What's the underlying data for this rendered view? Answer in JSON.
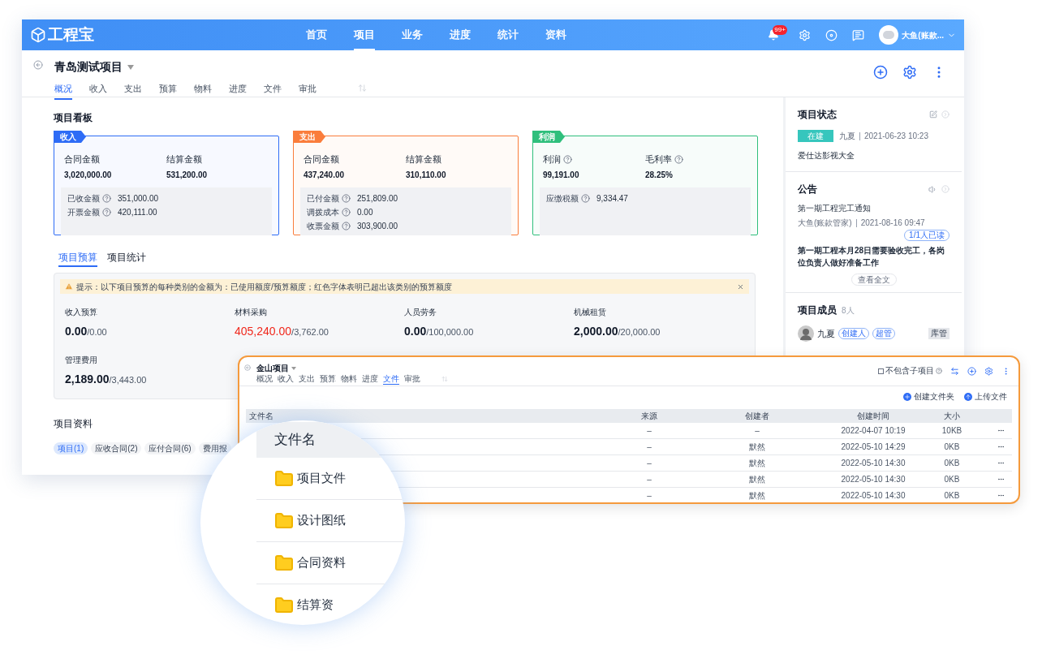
{
  "app": {
    "logo": "工程宝",
    "nav": [
      {
        "label": "首页",
        "selected": false
      },
      {
        "label": "项目",
        "selected": true
      },
      {
        "label": "业务",
        "selected": false
      },
      {
        "label": "进度",
        "selected": false
      },
      {
        "label": "统计",
        "selected": false
      },
      {
        "label": "资料",
        "selected": false
      }
    ],
    "notification_badge": "99+",
    "user_name": "大鱼(账款..."
  },
  "project": {
    "title": "青岛测试项目",
    "tabs": [
      {
        "label": "概况",
        "selected": true
      },
      {
        "label": "收入",
        "selected": false
      },
      {
        "label": "支出",
        "selected": false
      },
      {
        "label": "预算",
        "selected": false
      },
      {
        "label": "物料",
        "selected": false
      },
      {
        "label": "进度",
        "selected": false
      },
      {
        "label": "文件",
        "selected": false
      },
      {
        "label": "审批",
        "selected": false
      }
    ]
  },
  "board": {
    "title": "项目看板",
    "cards": [
      {
        "tag": "收入",
        "color": "#2e6cf6",
        "main": [
          {
            "label": "合同金额",
            "value": "3,020,000.00",
            "help": false
          },
          {
            "label": "结算金额",
            "value": "531,200.00",
            "help": false
          }
        ],
        "details": [
          {
            "label": "已收金额",
            "value": "351,000.00"
          },
          {
            "label": "开票金额",
            "value": "420,111.00"
          }
        ]
      },
      {
        "tag": "支出",
        "color": "#fa7d3c",
        "main": [
          {
            "label": "合同金额",
            "value": "437,240.00",
            "help": false
          },
          {
            "label": "结算金额",
            "value": "310,110.00",
            "help": false
          }
        ],
        "details": [
          {
            "label": "已付金额",
            "value": "251,809.00"
          },
          {
            "label": "调拨成本",
            "value": "0.00"
          },
          {
            "label": "收票金额",
            "value": "303,900.00"
          }
        ]
      },
      {
        "tag": "利润",
        "color": "#2fbf7c",
        "main": [
          {
            "label": "利润",
            "value": "99,191.00",
            "help": true
          },
          {
            "label": "毛利率",
            "value": "28.25%",
            "help": true
          }
        ],
        "details": [
          {
            "label": "应缴税额",
            "value": "9,334.47"
          }
        ]
      }
    ]
  },
  "budget": {
    "tabs": [
      {
        "label": "项目预算",
        "selected": true
      },
      {
        "label": "项目统计",
        "selected": false
      }
    ],
    "tip": "提示：以下项目预算的每种类别的金额为：已使用额度/预算额度；红色字体表明已超出该类别的预算额度",
    "items": [
      {
        "label": "收入预算",
        "used": "0.00",
        "total": "/0.00",
        "over": false
      },
      {
        "label": "材料采购",
        "used": "405,240.00",
        "total": "/3,762.00",
        "over": true
      },
      {
        "label": "人员劳务",
        "used": "0.00",
        "total": "/100,000.00",
        "over": false
      },
      {
        "label": "机械租赁",
        "used": "2,000.00",
        "total": "/20,000.00",
        "over": false
      },
      {
        "label": "管理费用",
        "used": "2,189.00",
        "total": "/3,443.00",
        "over": false
      }
    ]
  },
  "documents": {
    "title": "项目资料",
    "chips": [
      {
        "label": "项目(1)",
        "selected": true
      },
      {
        "label": "应收合同(2)",
        "selected": false
      },
      {
        "label": "应付合同(6)",
        "selected": false
      },
      {
        "label": "费用报",
        "selected": false
      }
    ]
  },
  "side": {
    "status": {
      "title": "项目状态",
      "badge": "在建",
      "user": "九夏",
      "time": "2021-06-23 10:23",
      "name": "爱仕达影视大全"
    },
    "notice": {
      "title": "公告",
      "heading": "第一期工程完工通知",
      "author": "大鱼(账款管家)",
      "time": "2021-08-16 09:47",
      "read": "1/1人已读",
      "body": "第一期工程本月28日需要验收完工，各岗位负责人做好准备工作",
      "more": "查看全文"
    },
    "members": {
      "title": "项目成员",
      "count": "8人",
      "list": [
        {
          "name": "九夏",
          "roles": [
            "创建人",
            "超管"
          ],
          "tag": "库管"
        }
      ]
    }
  },
  "overlay": {
    "title": "金山项目",
    "tabs": [
      {
        "label": "概况",
        "selected": false
      },
      {
        "label": "收入",
        "selected": false
      },
      {
        "label": "支出",
        "selected": false
      },
      {
        "label": "预算",
        "selected": false
      },
      {
        "label": "物料",
        "selected": false
      },
      {
        "label": "进度",
        "selected": false
      },
      {
        "label": "文件",
        "selected": true
      },
      {
        "label": "审批",
        "selected": false
      }
    ],
    "checkbox": {
      "label": "不包含子项目",
      "checked": false
    },
    "actions": [
      "创建文件夹",
      "上传文件"
    ],
    "columns": [
      "文件名",
      "来源",
      "创建者",
      "创建时间",
      "大小"
    ],
    "rows": [
      {
        "source": "–",
        "creator": "–",
        "time": "2022-04-07 10:19",
        "size": "10KB"
      },
      {
        "source": "–",
        "creator": "默然",
        "time": "2022-05-10 14:29",
        "size": "0KB"
      },
      {
        "source": "–",
        "creator": "默然",
        "time": "2022-05-10 14:30",
        "size": "0KB"
      },
      {
        "source": "–",
        "creator": "默然",
        "time": "2022-05-10 14:30",
        "size": "0KB"
      },
      {
        "source": "–",
        "creator": "默然",
        "time": "2022-05-10 14:30",
        "size": "0KB"
      }
    ]
  },
  "magnifier": {
    "header": "文件名",
    "rows": [
      "项目文件",
      "设计图纸",
      "合同资料",
      "结算资"
    ]
  }
}
